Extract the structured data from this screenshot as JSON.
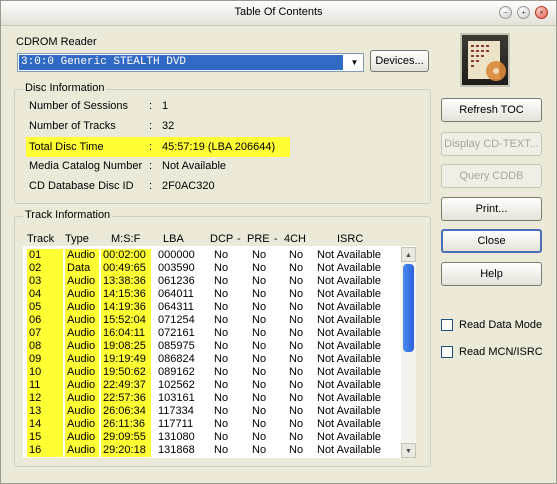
{
  "window": {
    "title": "Table Of Contents"
  },
  "reader": {
    "label": "CDROM Reader",
    "selected": "3:0:0 Generic  STEALTH DVD",
    "devices_button": "Devices..."
  },
  "disc_info": {
    "group_title": "Disc Information",
    "rows": [
      {
        "key": "Number of Sessions",
        "value": "1"
      },
      {
        "key": "Number of Tracks",
        "value": "32"
      },
      {
        "key": "Total Disc Time",
        "value": "45:57:19  (LBA 206644)"
      },
      {
        "key": "Media Catalog Number",
        "value": "Not Available"
      },
      {
        "key": "CD Database Disc ID",
        "value": "2F0AC320"
      }
    ],
    "separator": ":"
  },
  "track_info": {
    "group_title": "Track Information",
    "headers": [
      "Track",
      "Type",
      "M:S:F",
      "LBA",
      "DCP",
      "-",
      "PRE",
      "-",
      "4CH",
      "ISRC"
    ],
    "rows": [
      [
        "01",
        "Audio",
        "00:02:00",
        "000000",
        "No",
        "No",
        "No",
        "Not Available"
      ],
      [
        "02",
        "Data",
        "00:49:65",
        "003590",
        "No",
        "No",
        "No",
        "Not Available"
      ],
      [
        "03",
        "Audio",
        "13:38:36",
        "061236",
        "No",
        "No",
        "No",
        "Not Available"
      ],
      [
        "04",
        "Audio",
        "14:15:36",
        "064011",
        "No",
        "No",
        "No",
        "Not Available"
      ],
      [
        "05",
        "Audio",
        "14:19:36",
        "064311",
        "No",
        "No",
        "No",
        "Not Available"
      ],
      [
        "06",
        "Audio",
        "15:52:04",
        "071254",
        "No",
        "No",
        "No",
        "Not Available"
      ],
      [
        "07",
        "Audio",
        "16:04:11",
        "072161",
        "No",
        "No",
        "No",
        "Not Available"
      ],
      [
        "08",
        "Audio",
        "19:08:25",
        "085975",
        "No",
        "No",
        "No",
        "Not Available"
      ],
      [
        "09",
        "Audio",
        "19:19:49",
        "086824",
        "No",
        "No",
        "No",
        "Not Available"
      ],
      [
        "10",
        "Audio",
        "19:50:62",
        "089162",
        "No",
        "No",
        "No",
        "Not Available"
      ],
      [
        "11",
        "Audio",
        "22:49:37",
        "102562",
        "No",
        "No",
        "No",
        "Not Available"
      ],
      [
        "12",
        "Audio",
        "22:57:36",
        "103161",
        "No",
        "No",
        "No",
        "Not Available"
      ],
      [
        "13",
        "Audio",
        "26:06:34",
        "117334",
        "No",
        "No",
        "No",
        "Not Available"
      ],
      [
        "14",
        "Audio",
        "26:11:36",
        "117711",
        "No",
        "No",
        "No",
        "Not Available"
      ],
      [
        "15",
        "Audio",
        "29:09:55",
        "131080",
        "No",
        "No",
        "No",
        "Not Available"
      ],
      [
        "16",
        "Audio",
        "29:20:18",
        "131868",
        "No",
        "No",
        "No",
        "Not Available"
      ]
    ]
  },
  "buttons": {
    "refresh_toc": "Refresh TOC",
    "display_cd_text": "Display CD-TEXT...",
    "query_cddb": "Query CDDB",
    "print": "Print...",
    "close": "Close",
    "help": "Help"
  },
  "options": {
    "read_data_mode": "Read Data Mode",
    "read_mcn_isrc": "Read MCN/ISRC"
  },
  "colors": {
    "highlight": "#ffff33",
    "selection": "#316ac5"
  }
}
